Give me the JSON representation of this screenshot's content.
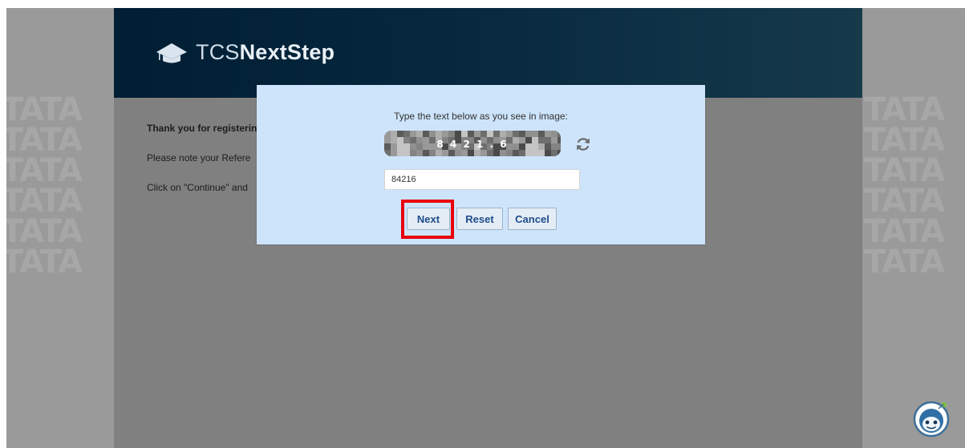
{
  "header": {
    "logo_thin": "TCS",
    "logo_bold": "NextStep"
  },
  "watermark": {
    "text": "TATA"
  },
  "content": {
    "line1": "Thank you for registerin",
    "line2": "Please note your Refere",
    "line3": "Click on \"Continue\" and"
  },
  "dialog": {
    "prompt": "Type the text below as you see in image:",
    "captcha_text": "8 4 2 1 . 6",
    "input_value": "84216",
    "next_label": "Next",
    "reset_label": "Reset",
    "cancel_label": "Cancel"
  },
  "icons": {
    "logo": "graduation-cap-icon",
    "refresh": "refresh-icon",
    "chatbot": "chatbot-icon"
  },
  "colors": {
    "header_start": "#003a63",
    "header_end": "#2b6f8f",
    "dialog_bg": "#cde4fb",
    "button_text": "#1d4c8a",
    "highlight": "#e8000b"
  }
}
